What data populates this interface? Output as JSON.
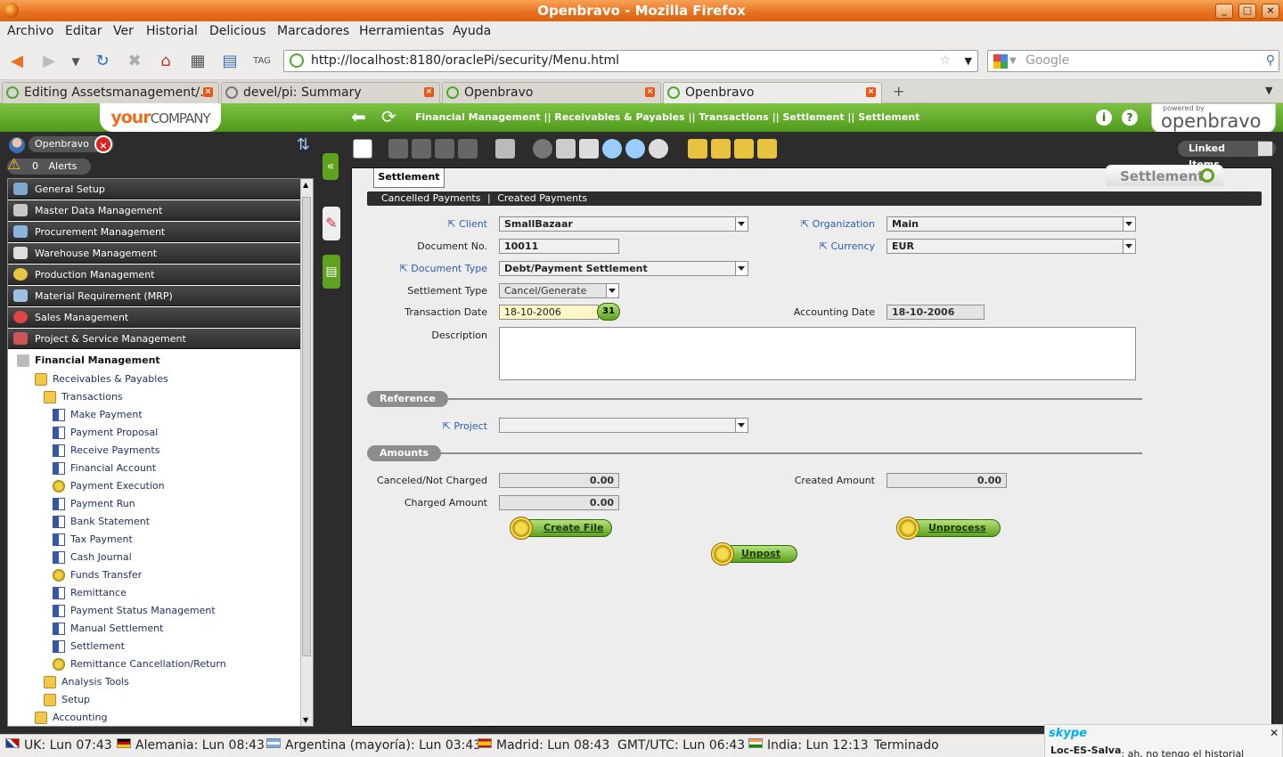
{
  "window": {
    "title": "Openbravo - Mozilla Firefox"
  },
  "menubar": [
    "Archivo",
    "Editar",
    "Ver",
    "Historial",
    "Delicious",
    "Marcadores",
    "Herramientas",
    "Ayuda"
  ],
  "navbar": {
    "url": "http://localhost:8180/oraclePi/security/Menu.html",
    "search_placeholder": "Google"
  },
  "tabs": [
    {
      "label": "Editing Assetsmanagement/...",
      "active": false
    },
    {
      "label": "devel/pi: Summary",
      "active": false
    },
    {
      "label": "Openbravo",
      "active": false
    },
    {
      "label": "Openbravo",
      "active": true
    }
  ],
  "app": {
    "logo_main": "your",
    "logo_sub": "COMPANY",
    "breadcrumb": "Financial Management || Receivables & Payables || Transactions || Settlement  ||  Settlement",
    "powered_by": "powered by",
    "brand": "openbravo",
    "user": "Openbravo",
    "alerts_count": "0",
    "alerts_label": "Alerts",
    "linked_items": "Linked Items"
  },
  "menu": {
    "categories": [
      "General Setup",
      "Master Data Management",
      "Procurement Management",
      "Warehouse Management",
      "Production Management",
      "Material Requirement (MRP)",
      "Sales Management",
      "Project & Service Management"
    ],
    "open_category": "Financial Management",
    "items": [
      {
        "label": "Receivables & Payables",
        "icon": "folder-icon",
        "level": 1
      },
      {
        "label": "Transactions",
        "icon": "folder-icon",
        "level": 2
      },
      {
        "label": "Make Payment",
        "icon": "form-icon",
        "level": 3
      },
      {
        "label": "Payment Proposal",
        "icon": "form-icon",
        "level": 3
      },
      {
        "label": "Receive Payments",
        "icon": "form-icon",
        "level": 3
      },
      {
        "label": "Financial Account",
        "icon": "form-icon",
        "level": 3
      },
      {
        "label": "Payment Execution",
        "icon": "process-icon",
        "level": 3
      },
      {
        "label": "Payment Run",
        "icon": "form-icon",
        "level": 3
      },
      {
        "label": "Bank Statement",
        "icon": "form-icon",
        "level": 3
      },
      {
        "label": "Tax Payment",
        "icon": "form-icon",
        "level": 3
      },
      {
        "label": "Cash Journal",
        "icon": "form-icon",
        "level": 3
      },
      {
        "label": "Funds Transfer",
        "icon": "process-icon",
        "level": 3
      },
      {
        "label": "Remittance",
        "icon": "form-icon",
        "level": 3
      },
      {
        "label": "Payment Status Management",
        "icon": "form-icon",
        "level": 3
      },
      {
        "label": "Manual Settlement",
        "icon": "form-icon",
        "level": 3
      },
      {
        "label": "Settlement",
        "icon": "form-icon",
        "level": 3
      },
      {
        "label": "Remittance Cancellation/Return",
        "icon": "process-icon",
        "level": 3
      },
      {
        "label": "Analysis Tools",
        "icon": "folder-icon",
        "level": 2
      },
      {
        "label": "Setup",
        "icon": "folder-icon",
        "level": 2
      },
      {
        "label": "Accounting",
        "icon": "folder-icon",
        "level": 1
      }
    ]
  },
  "form": {
    "active_tab": "Settlement",
    "window_title": "Settlement",
    "subtabs": [
      "Cancelled Payments",
      "Created Payments"
    ],
    "labels": {
      "client": "Client",
      "organization": "Organization",
      "document_no": "Document No.",
      "currency": "Currency",
      "document_type": "Document Type",
      "settlement_type": "Settlement Type",
      "transaction_date": "Transaction Date",
      "accounting_date": "Accounting Date",
      "description": "Description",
      "project": "Project",
      "canceled": "Canceled/Not Charged",
      "created_amount": "Created Amount",
      "charged_amount": "Charged Amount"
    },
    "values": {
      "client": "SmallBazaar",
      "organization": "Main",
      "document_no": "10011",
      "currency": "EUR",
      "document_type": "Debt/Payment Settlement",
      "settlement_type": "Cancel/Generate",
      "transaction_date": "18-10-2006",
      "calendar_day": "31",
      "accounting_date": "18-10-2006",
      "description": "",
      "project": "",
      "canceled": "0.00",
      "created_amount": "0.00",
      "charged_amount": "0.00"
    },
    "sections": {
      "reference": "Reference",
      "amounts": "Amounts"
    },
    "buttons": {
      "create_file": "Create File",
      "unprocess": "Unprocess",
      "unpost": "Unpost"
    }
  },
  "statusbar": {
    "clocks": [
      "UK: Lun 07:43",
      "Alemania: Lun 08:43",
      "Argentina (mayoría): Lun 03:43",
      "Madrid: Lun 08:43",
      "GMT/UTC: Lun 06:43",
      "India: Lun 12:13"
    ],
    "status": "Terminado",
    "skype_brand": "skype",
    "skype_message_sender": "Loc-ES-Salva",
    "skype_message": ": ah, no tengo el historial"
  }
}
